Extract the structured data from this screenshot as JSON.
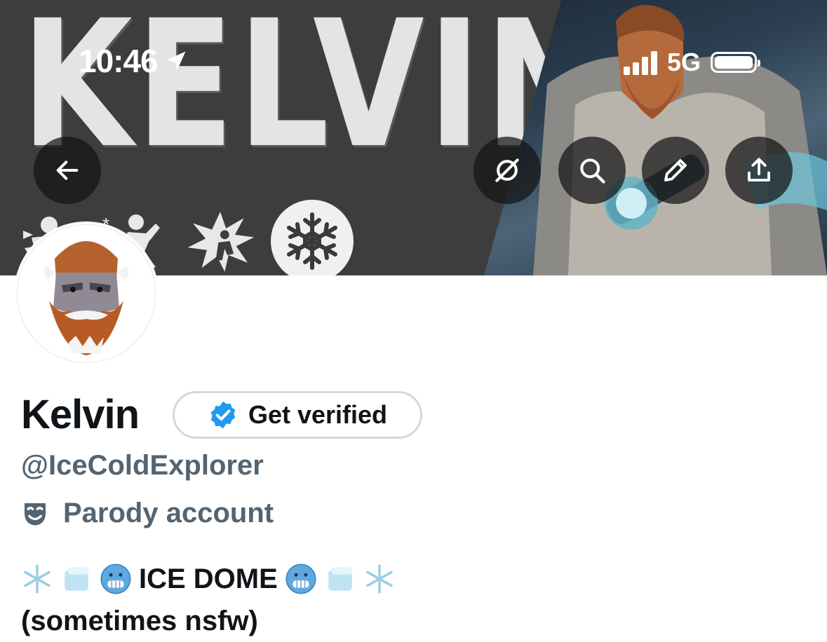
{
  "status_bar": {
    "time": "10:46",
    "location_icon": "location-arrow-icon",
    "network": "5G",
    "signal_icon": "cellular-signal-icon",
    "battery_icon": "battery-icon"
  },
  "banner": {
    "word": "KELVIN",
    "icons": [
      "ability-hit-icon",
      "ability-run-icon",
      "ability-burst-icon",
      "snowflake-icon"
    ]
  },
  "toolbar": {
    "back_icon": "arrow-left-icon",
    "hide_icon": "eye-slash-icon",
    "search_icon": "search-icon",
    "edit_icon": "pencil-icon",
    "share_icon": "share-icon"
  },
  "profile": {
    "name": "Kelvin",
    "get_verified_label": "Get verified",
    "handle": "@IceColdExplorer",
    "parody_label": "Parody account",
    "bio_line1_text": "ICE DOME",
    "bio_line2": "(sometimes nsfw)"
  },
  "colors": {
    "text_primary": "#0f1419",
    "text_secondary": "#536471",
    "verified_blue": "#1d9bf0",
    "border": "#cfd9de"
  }
}
